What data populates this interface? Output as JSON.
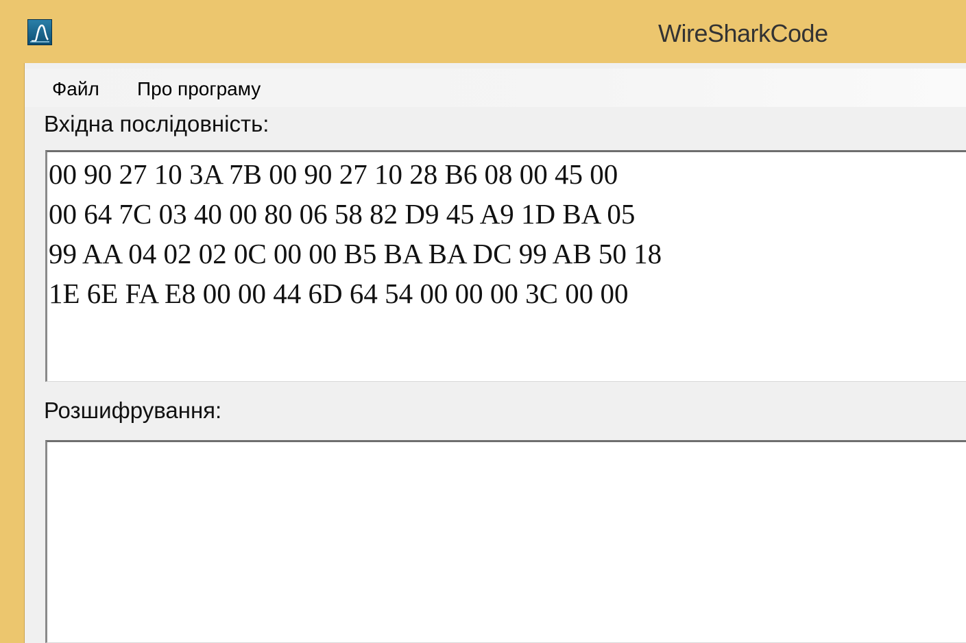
{
  "window": {
    "title": "WireSharkCode",
    "icon": "wireshark-fin-icon"
  },
  "menu": {
    "items": [
      {
        "label": "Файл"
      },
      {
        "label": "Про програму"
      }
    ]
  },
  "input_section": {
    "label": "Вхідна послідовність:",
    "lines": [
      "00 90 27 10 3A 7B 00 90 27 10 28 B6 08 00 45 00",
      "00 64 7C 03 40 00 80 06 58 82 D9 45 A9 1D BA 05",
      "99 AA 04 02 02 0C 00 00 B5 BA BA DC 99 AB 50 18",
      "1E 6E FA E8 00 00 44 6D 64 54 00 00 00 3C 00 00"
    ]
  },
  "output_section": {
    "label": "Розшифрування:",
    "value": ""
  },
  "colors": {
    "titlebar": "#ecc66e",
    "client_bg": "#f0f0f0",
    "textbox_bg": "#ffffff"
  }
}
